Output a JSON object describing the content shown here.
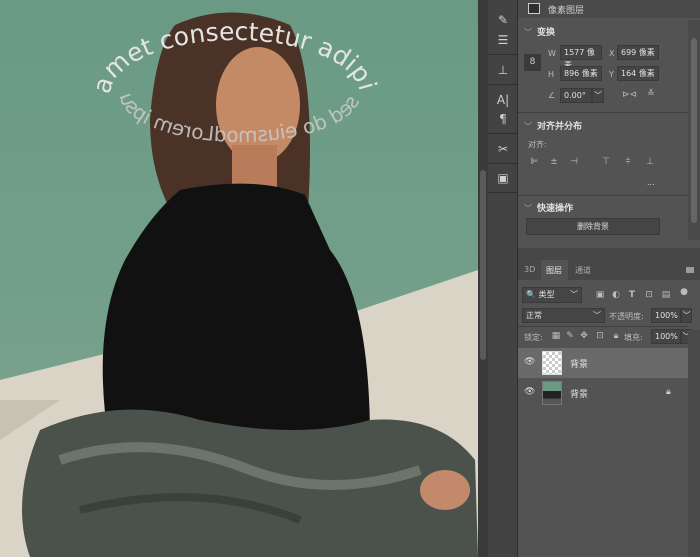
{
  "canvas": {
    "curved_text_top": "amet consectetur adipisicing",
    "curved_text_back": "sed do eiusmodLorem ipsum dolor"
  },
  "toolbar": {
    "tools": [
      "brush-settings-icon",
      "adjust-icon",
      "clone-source-icon",
      "character-icon",
      "paragraph-icon",
      "tools-icon",
      "glyphs-icon"
    ]
  },
  "properties": {
    "header": "像素图层",
    "transform": {
      "title": "变换",
      "w_label": "W",
      "w": "1577 像素",
      "x_label": "X",
      "x": "699 像素",
      "h_label": "H",
      "h": "896 像素",
      "y_label": "Y",
      "y": "164 像素",
      "angle": "0.00°"
    },
    "align": {
      "title": "对齐并分布",
      "label": "对齐:",
      "more": "..."
    },
    "quick": {
      "title": "快速操作",
      "remove_bg": "删除背景"
    }
  },
  "layers_panel": {
    "tabs": [
      "3D",
      "图层",
      "通道"
    ],
    "active_tab": "图层",
    "filter": "类型",
    "blend_mode": "正常",
    "opacity_label": "不透明度:",
    "opacity": "100%",
    "lock_label": "锁定:",
    "fill_label": "填充:",
    "fill": "100%",
    "layers": [
      {
        "name": "背景",
        "selected": true,
        "locked": false
      },
      {
        "name": "背景",
        "selected": false,
        "locked": true
      }
    ]
  }
}
